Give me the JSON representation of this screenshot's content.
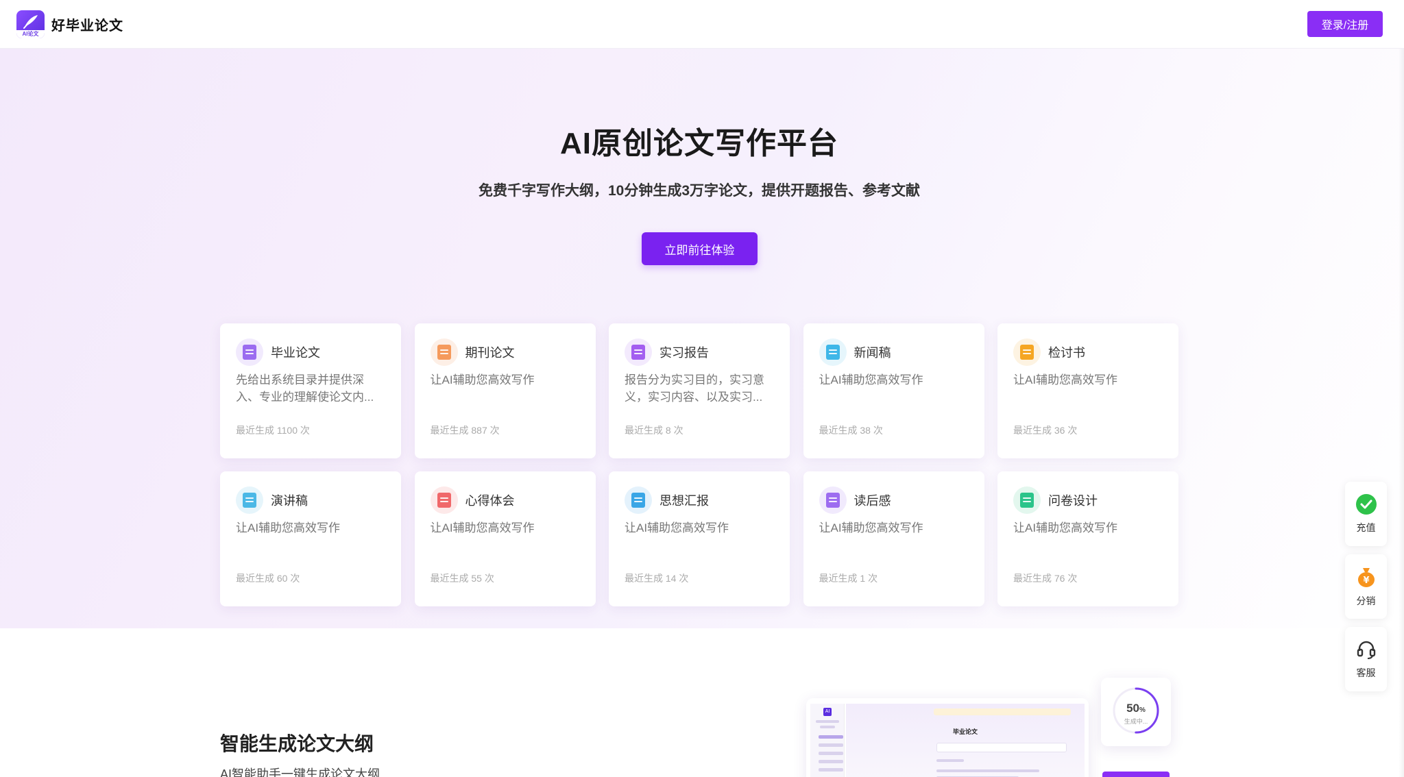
{
  "header": {
    "brand_name": "好毕业论文",
    "logo_text": "AI论文",
    "login_label": "登录/注册"
  },
  "hero": {
    "title": "AI原创论文写作平台",
    "subtitle": "免费千字写作大纲，10分钟生成3万字论文，提供开题报告、参考文献",
    "cta_label": "立即前往体验"
  },
  "cards": [
    {
      "title": "毕业论文",
      "desc": "先给出系统目录并提供深入、专业的理解使论文内...",
      "count": "最近生成 1100 次",
      "icon": "graduation-cap-icon",
      "color": "#9b6cf0",
      "bg": "#f1eafd"
    },
    {
      "title": "期刊论文",
      "desc": "让AI辅助您高效写作",
      "count": "最近生成 887 次",
      "icon": "journal-icon",
      "color": "#f59a5c",
      "bg": "#fdefe6"
    },
    {
      "title": "实习报告",
      "desc": "报告分为实习目的，实习意义，实习内容、以及实习...",
      "count": "最近生成 8 次",
      "icon": "report-icon",
      "color": "#a35ef0",
      "bg": "#f3eafd"
    },
    {
      "title": "新闻稿",
      "desc": "让AI辅助您高效写作",
      "count": "最近生成 38 次",
      "icon": "news-icon",
      "color": "#3fb7e8",
      "bg": "#e6f6fc"
    },
    {
      "title": "检讨书",
      "desc": "让AI辅助您高效写作",
      "count": "最近生成 36 次",
      "icon": "envelope-icon",
      "color": "#f5a623",
      "bg": "#fdf3e2"
    },
    {
      "title": "演讲稿",
      "desc": "让AI辅助您高效写作",
      "count": "最近生成 60 次",
      "icon": "speech-icon",
      "color": "#4bb8e6",
      "bg": "#e6f5fb"
    },
    {
      "title": "心得体会",
      "desc": "让AI辅助您高效写作",
      "count": "最近生成 55 次",
      "icon": "heart-book-icon",
      "color": "#f0686a",
      "bg": "#fde9e9"
    },
    {
      "title": "思想汇报",
      "desc": "让AI辅助您高效写作",
      "count": "最近生成 14 次",
      "icon": "document-icon",
      "color": "#3aa6e6",
      "bg": "#e4f2fc"
    },
    {
      "title": "读后感",
      "desc": "让AI辅助您高效写作",
      "count": "最近生成 1 次",
      "icon": "book-icon",
      "color": "#9d6cf0",
      "bg": "#f1eafd"
    },
    {
      "title": "问卷设计",
      "desc": "让AI辅助您高效写作",
      "count": "最近生成 76 次",
      "icon": "questionnaire-icon",
      "color": "#2bc48a",
      "bg": "#e3f7ee"
    }
  ],
  "side_tools": {
    "recharge": "充值",
    "distribution": "分销",
    "service": "客服"
  },
  "feature": {
    "title": "智能生成论文大纲",
    "subtitle": "AI智能助手一键生成论文大纲",
    "preview_title": "毕业论文",
    "preview_logo": "AI",
    "progress_value": "50",
    "progress_unit": "%",
    "progress_label": "生成中..."
  },
  "colors": {
    "accent": "#8a2ef5",
    "cta": "#7a22f0",
    "wechat_green": "#2ec24a",
    "coin_orange": "#f7941d"
  }
}
